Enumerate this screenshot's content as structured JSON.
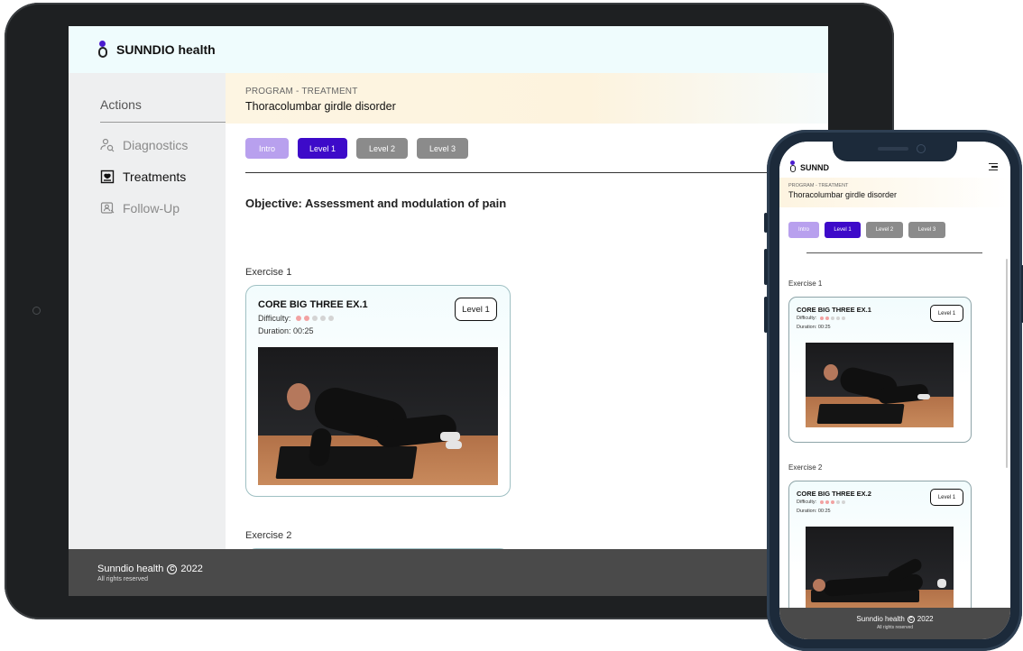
{
  "brand": {
    "name": "SUNNDIO health"
  },
  "sidebar": {
    "title": "Actions",
    "items": [
      {
        "label": "Diagnostics",
        "icon": "diagnostics-icon",
        "active": false
      },
      {
        "label": "Treatments",
        "icon": "treatments-icon",
        "active": true
      },
      {
        "label": "Follow-Up",
        "icon": "follow-up-icon",
        "active": false
      }
    ]
  },
  "program": {
    "kicker": "PROGRAM - TREATMENT",
    "title": "Thoracolumbar girdle disorder"
  },
  "levels": [
    "Intro",
    "Level 1",
    "Level 2",
    "Level 3"
  ],
  "objective": "Objective: Assessment and modulation of pain",
  "exercises": [
    {
      "section": "Exercise 1",
      "name": "CORE BIG THREE EX.1",
      "difficulty_label": "Difficulty:",
      "difficulty": 2,
      "difficulty_max": 5,
      "duration": "Duration: 00:25",
      "level_badge": "Level 1"
    },
    {
      "section": "Exercise 2",
      "name": "CORE BIG THREE EX.2",
      "difficulty_label": "Difficulty:",
      "difficulty": 3,
      "difficulty_max": 5,
      "duration": "Duration: 00:25",
      "level_badge": "Level 1"
    }
  ],
  "footer": {
    "company": "Sunndio health",
    "year": "2022",
    "rights": "All rights reserved"
  },
  "phone": {
    "brand_short": "SUNND"
  },
  "colors": {
    "accent": "#3d0ac9",
    "intro": "#b8a0ee",
    "inactive_level": "#8b8b8b",
    "footer": "#4a4a4a",
    "header_bg": "#effcfd",
    "difficulty_on": "#f2a2a2"
  }
}
